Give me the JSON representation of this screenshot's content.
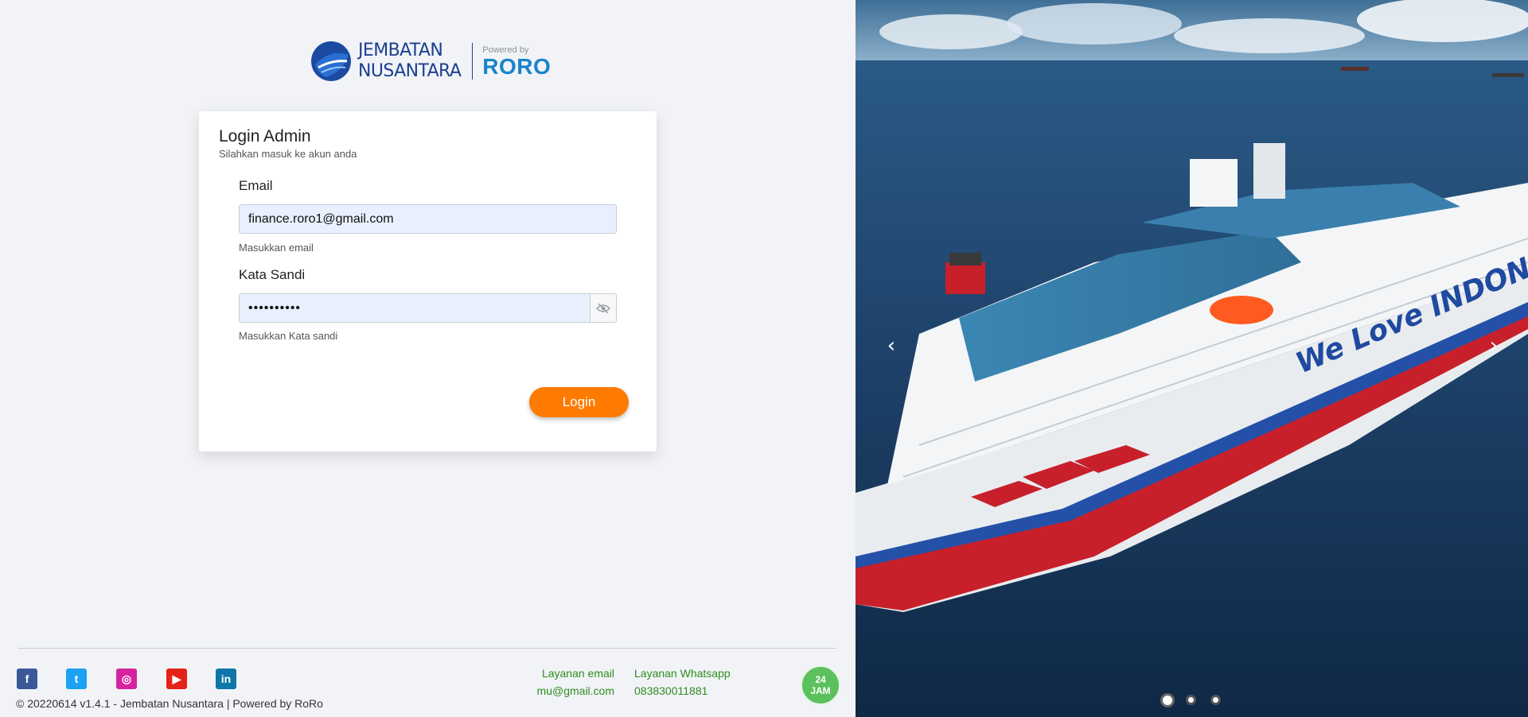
{
  "brand": {
    "line1": "JEMBATAN",
    "line2": "NUSANTARA",
    "powered_label": "Powered by",
    "partner": "RORO"
  },
  "login": {
    "title": "Login Admin",
    "subtitle": "Silahkan masuk ke akun anda",
    "email_label": "Email",
    "email_value": "finance.roro1@gmail.com",
    "email_hint": "Masukkan email",
    "password_label": "Kata Sandi",
    "password_value": "••••••••••",
    "password_hint": "Masukkan Kata sandi",
    "submit_label": "Login",
    "password_toggle_icon": "eye-slash-icon"
  },
  "footer": {
    "social": [
      {
        "name": "facebook-icon",
        "glyph": "f",
        "color": "#3b5998"
      },
      {
        "name": "twitter-icon",
        "glyph": "t",
        "color": "#1da1f2"
      },
      {
        "name": "instagram-icon",
        "glyph": "◎",
        "color": "#d6249f"
      },
      {
        "name": "youtube-icon",
        "glyph": "▶",
        "color": "#e62117"
      },
      {
        "name": "linkedin-icon",
        "glyph": "in",
        "color": "#0e76a8"
      }
    ],
    "copyright": "© 20220614 v1.4.1 - Jembatan Nusantara | Powered by RoRo",
    "email_service_label": "Layanan email",
    "email_service_value": "mu@gmail.com",
    "whatsapp_service_label": "Layanan Whatsapp",
    "whatsapp_service_value": "083830011881",
    "badge_line1": "24",
    "badge_line2": "JAM",
    "accent_green": "#2f8c1f"
  },
  "carousel": {
    "slide_text": "We Love INDONESIA",
    "prev_icon": "chevron-left-icon",
    "next_icon": "chevron-right-icon",
    "prev_glyph": "‹",
    "next_glyph": "›",
    "slides_count": 3,
    "active_index": 0
  },
  "colors": {
    "primary_orange": "#ff7a00",
    "brand_blue": "#1c3f8f",
    "input_bg": "#e8f0fe"
  }
}
